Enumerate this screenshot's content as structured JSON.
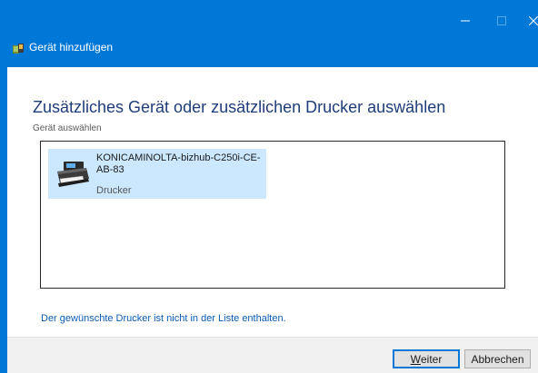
{
  "window": {
    "title": "Gerät hinzufügen",
    "controls": {
      "minimize_icon": "minimize-icon",
      "maximize_icon": "maximize-icon",
      "close_icon": "close-icon"
    }
  },
  "main": {
    "heading": "Zusätzliches Gerät oder zusätzlichen Drucker auswählen",
    "subheading": "Gerät auswählen",
    "devices": [
      {
        "name": "KONICAMINOLTA-bizhub-C250i-CE-AB-83",
        "type": "Drucker",
        "icon": "printer-icon",
        "selected": true
      }
    ],
    "not_listed_link": "Der gewünschte Drucker ist nicht in der Liste enthalten."
  },
  "footer": {
    "next_label_accel": "W",
    "next_label_rest": "eiter",
    "cancel_label": "Abbrechen"
  },
  "colors": {
    "titlebar": "#0078d7",
    "selection": "#cce8ff",
    "heading": "#1f3d7a",
    "link": "#0a5db8"
  }
}
